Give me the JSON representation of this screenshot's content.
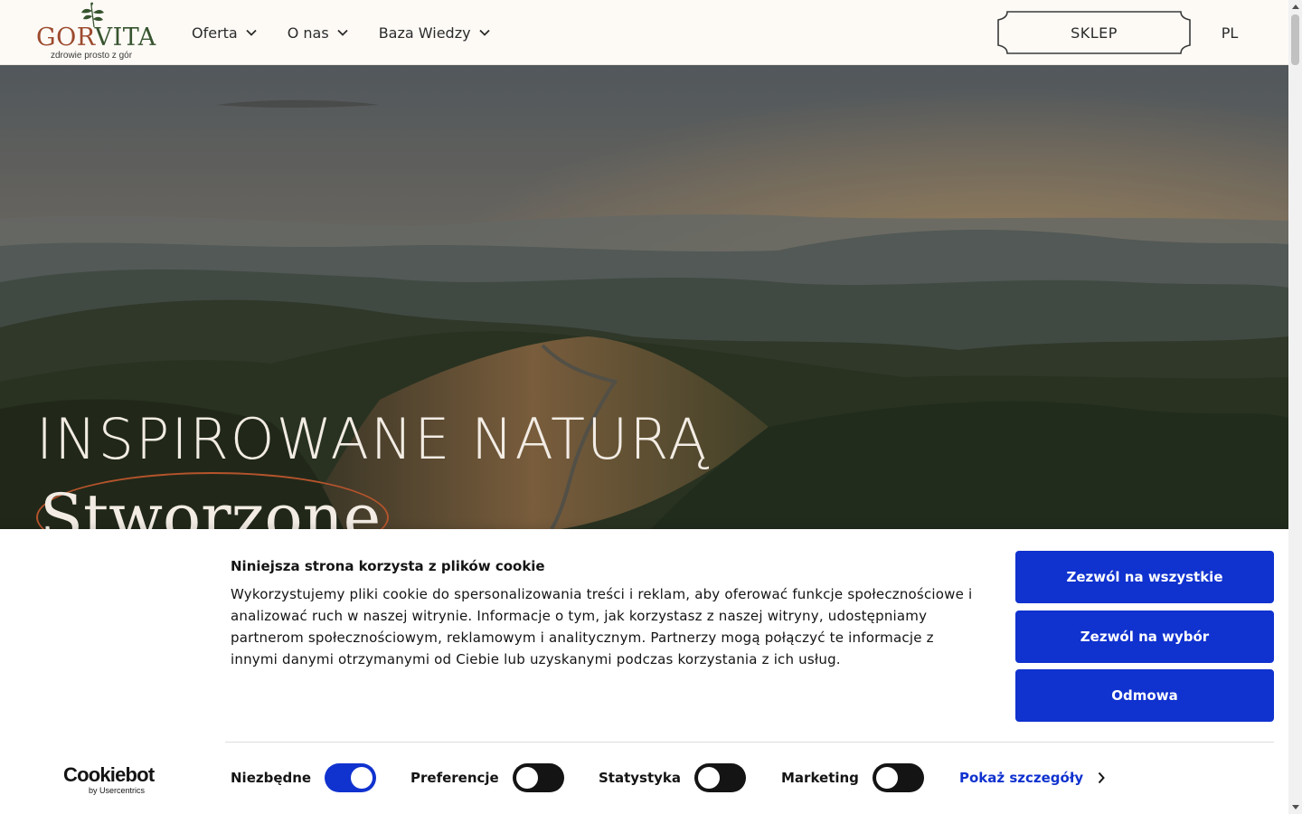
{
  "header": {
    "logo": {
      "wordmark_part1": "GOR",
      "wordmark_part2": "VITA",
      "tagline": "zdrowie prosto z gór"
    },
    "nav": [
      {
        "label": "Oferta",
        "icon": "chevron-down-icon"
      },
      {
        "label": "O nas",
        "icon": "chevron-down-icon"
      },
      {
        "label": "Baza Wiedzy",
        "icon": "chevron-down-icon"
      }
    ],
    "shop_label": "SKLEP",
    "language": "PL"
  },
  "hero": {
    "title": "INSPIROWANE NATURĄ",
    "subtitle": "Stworzone"
  },
  "cookie_banner": {
    "title": "Niniejsza strona korzysta z plików cookie",
    "text": "Wykorzystujemy pliki cookie do spersonalizowania treści i reklam, aby oferować funkcje społecznościowe i analizować ruch w naszej witrynie. Informacje o tym, jak korzystasz z naszej witryny, udostępniamy partnerom społecznościowym, reklamowym i analitycznym. Partnerzy mogą połączyć te informacje z innymi danymi otrzymanymi od Ciebie lub uzyskanymi podczas korzystania z ich usług.",
    "buttons": {
      "allow_all": "Zezwól na wszystkie",
      "allow_selection": "Zezwól na wybór",
      "deny": "Odmowa"
    },
    "brand": {
      "name": "Cookiebot",
      "by": "by Usercentrics"
    },
    "toggles": [
      {
        "label": "Niezbędne",
        "checked": true
      },
      {
        "label": "Preferencje",
        "checked": false
      },
      {
        "label": "Statystyka",
        "checked": false
      },
      {
        "label": "Marketing",
        "checked": false
      }
    ],
    "details_link": "Pokaż szczegóły"
  },
  "colors": {
    "accent_blue": "#1032cf",
    "logo_rust": "#9c4a2e",
    "logo_green": "#37542f",
    "hero_oval": "#b4542c"
  }
}
